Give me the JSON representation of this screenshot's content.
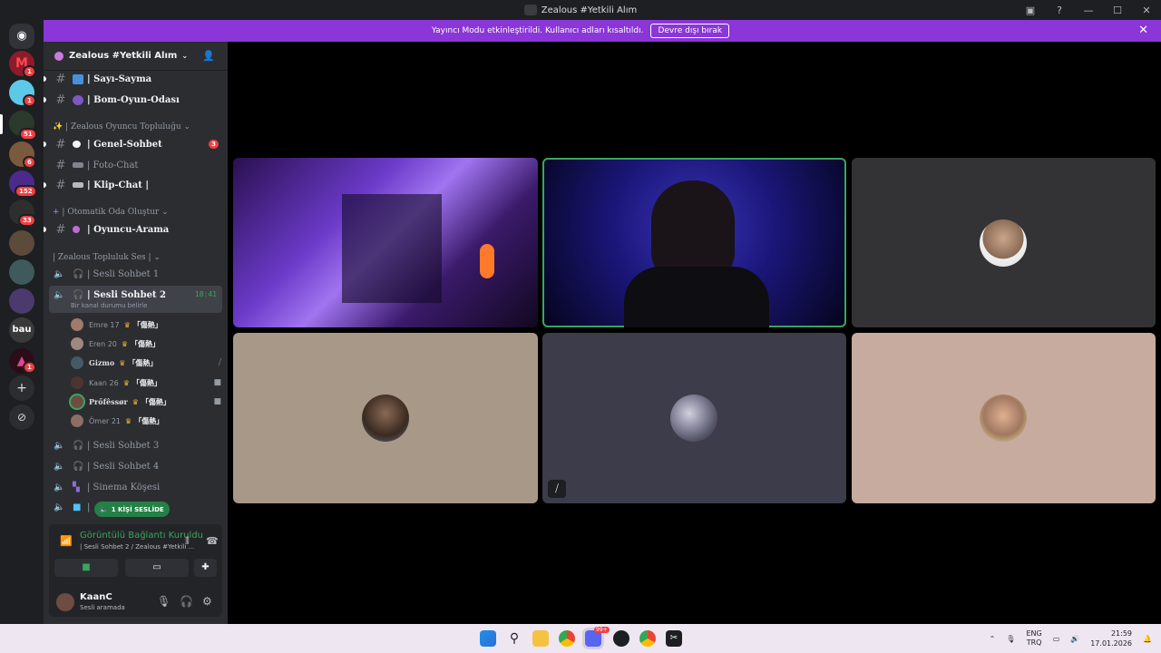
{
  "window": {
    "title": "Zealous #Yetkili Alım"
  },
  "banner": {
    "text": "Yayıncı Modu etkinleştirildi. Kullanıcı adları kısaltıldı.",
    "button": "Devre dışı bırak"
  },
  "rail_badges": [
    "1",
    "1",
    "51",
    "6",
    "152",
    "33",
    "1"
  ],
  "rail_text_server": "bau",
  "server": {
    "name": "Zealous #Yetkili Alım"
  },
  "channels": {
    "top": [
      {
        "label": "| Sayı-Sayma"
      },
      {
        "label": "| Bom-Oyun-Odası"
      }
    ],
    "cat1": "| Zealous Oyuncu Topluluğu",
    "cat1_channels": [
      {
        "label": "| Genel-Sohbet",
        "badge": "3"
      },
      {
        "label": "| Foto-Chat"
      },
      {
        "label": "| Klip-Chat |"
      }
    ],
    "cat2": "| Otomatik Oda Oluştur",
    "cat2_channels": [
      {
        "label": "| Oyuncu-Arama"
      }
    ],
    "cat3": "| Zealous Topluluk Ses |",
    "voice": [
      {
        "label": "| Sesli Sohbet 1"
      },
      {
        "label": "| Sesli Sohbet 2",
        "time": "18:41",
        "status": "Bir kanal durumu belirle"
      },
      {
        "label": "| Sesli Sohbet 3"
      },
      {
        "label": "| Sesli Sohbet 4"
      },
      {
        "label": "| Sinema Köşesi"
      },
      {
        "label": "|"
      }
    ],
    "members": [
      {
        "name": "Emre 17",
        "tag": "「傷熱」"
      },
      {
        "name": "Eren 20",
        "tag": "「傷熱」"
      },
      {
        "name": "Gizmo",
        "tag": "「傷熱」"
      },
      {
        "name": "Kaan 26",
        "tag": "「傷熱」"
      },
      {
        "name": "Prőfêssør",
        "tag": "「傷熱」"
      },
      {
        "name": "Ömer 21",
        "tag": "「傷熱」"
      }
    ],
    "voice_pill": "1 KİŞİ SESLİDE"
  },
  "voice_panel": {
    "status": "Görüntülü Bağlantı Kuruldu",
    "sub": "| Sesli Sohbet 2 / Zealous #Yetkili ...",
    "user": "KaanC",
    "user_status": "Sesli aramada"
  },
  "taskbar": {
    "lang_top": "ENG",
    "lang_bottom": "TRQ",
    "time": "21:59",
    "date": "17.01.2026",
    "discord_badge": "99+"
  },
  "colors": {
    "banner": "#8a36d9",
    "speaking": "#3ba55d",
    "mention": "#f23f43"
  }
}
